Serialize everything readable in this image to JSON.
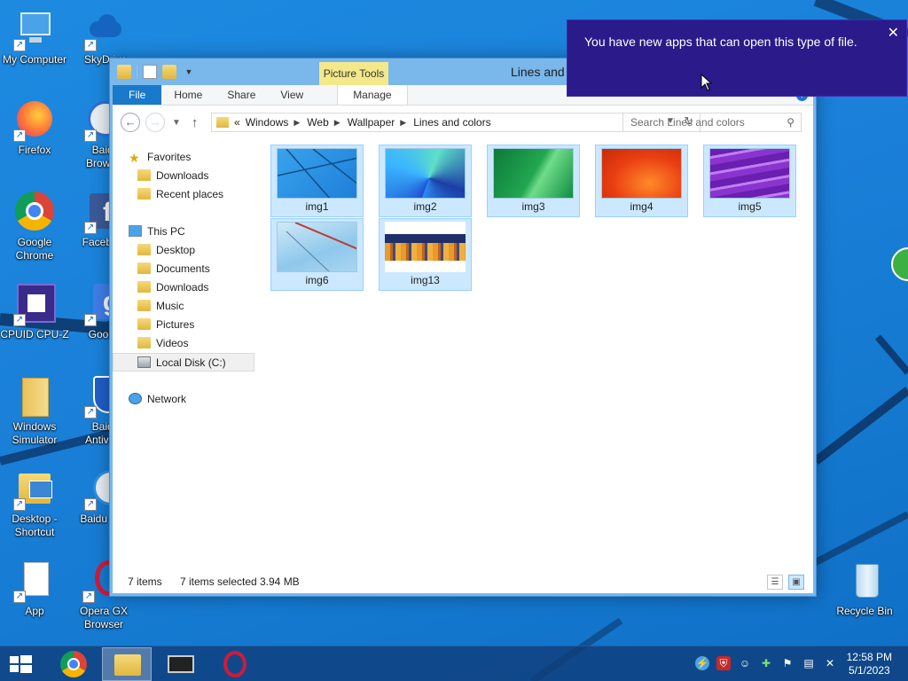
{
  "desktop": {
    "icons": [
      {
        "label": "My Computer"
      },
      {
        "label": "SkyDrive"
      },
      {
        "label": "Firefox"
      },
      {
        "label": "Baidu Browser"
      },
      {
        "label": "Google Chrome"
      },
      {
        "label": "Facebook"
      },
      {
        "label": "CPUID CPU-Z"
      },
      {
        "label": "Google"
      },
      {
        "label": "Windows Simulator"
      },
      {
        "label": "Baidu Antivirus"
      },
      {
        "label": "Desktop - Shortcut"
      },
      {
        "label": "Baidu Fast"
      },
      {
        "label": "App"
      },
      {
        "label": "Opera GX Browser"
      },
      {
        "label": "Recycle Bin"
      }
    ]
  },
  "explorer": {
    "title": "Lines and colors",
    "contextual_tab": "Picture Tools",
    "ribbon_tabs": {
      "file": "File",
      "home": "Home",
      "share": "Share",
      "view": "View",
      "manage": "Manage"
    },
    "address": {
      "overflow": "«",
      "crumbs": [
        "Windows",
        "Web",
        "Wallpaper",
        "Lines and colors"
      ]
    },
    "search": {
      "placeholder": "Search Lines and colors"
    },
    "nav": {
      "favorites": "Favorites",
      "fav_downloads": "Downloads",
      "recent_places": "Recent places",
      "this_pc": "This PC",
      "desktop": "Desktop",
      "documents": "Documents",
      "downloads": "Downloads",
      "music": "Music",
      "pictures": "Pictures",
      "videos": "Videos",
      "local_disk": "Local Disk (C:)",
      "network": "Network"
    },
    "files": [
      "img1",
      "img2",
      "img3",
      "img4",
      "img5",
      "img6",
      "img13"
    ],
    "status": {
      "items": "7 items",
      "selected": "7 items selected",
      "size": "3.94 MB"
    }
  },
  "toast": {
    "message": "You have new apps that can open this type of file.",
    "close": "✕"
  },
  "taskbar": {
    "time": "12:58 PM",
    "date": "5/1/2023"
  },
  "colors": {
    "accent": "#1979ca",
    "toast_bg": "#2b1a89",
    "selection": "#cce8ff"
  }
}
